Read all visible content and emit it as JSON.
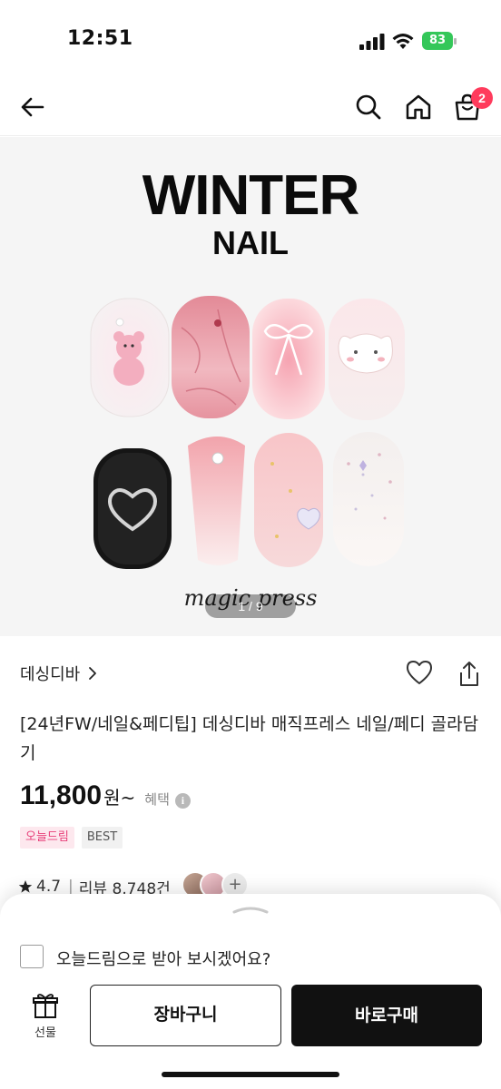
{
  "status_bar": {
    "time": "12:51",
    "battery": "83"
  },
  "nav": {
    "cart_count": "2"
  },
  "product_image": {
    "title": "WINTER",
    "subtitle": "NAIL",
    "brand_logo": "magic press",
    "counter": "1 / 9"
  },
  "seller": {
    "name": "데싱디바"
  },
  "product": {
    "title": "[24년FW/네일&페디팁] 데싱디바 매직프레스 네일/페디 골라담기",
    "price": "11,800",
    "price_unit": "원~",
    "benefit_label": "혜택",
    "tags": [
      "오늘드림",
      "BEST"
    ],
    "rating": "4.7",
    "review_label": "리뷰 8,748건",
    "more_reviewers": "+"
  },
  "bottom_sheet": {
    "checkbox_label": "오늘드림으로 받아 보시겠어요?",
    "gift_label": "선물",
    "cart_button": "장바구니",
    "buy_button": "바로구매"
  },
  "colors": {
    "badge": "#ff3b5c",
    "battery": "#34c759",
    "dream_tag_text": "#e8407a",
    "buy_button_bg": "#111111"
  },
  "icons": [
    "back-arrow-icon",
    "search-icon",
    "home-icon",
    "shopping-bag-icon",
    "chevron-right-icon",
    "heart-icon",
    "share-icon",
    "star-icon",
    "info-icon",
    "gift-icon",
    "chevron-handle-icon"
  ]
}
